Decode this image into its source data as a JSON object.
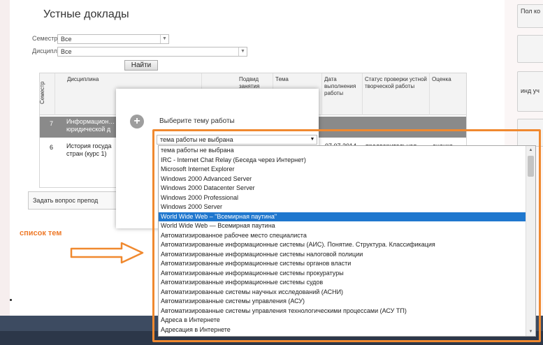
{
  "page": {
    "title": "Устные доклады",
    "filters": [
      {
        "label": "Семестр",
        "value": "Все"
      },
      {
        "label": "Дисциплина",
        "value": "Все"
      }
    ],
    "search_button": "Найти",
    "ask_teacher": "Задать вопрос препод"
  },
  "grid": {
    "headers": {
      "semester": "Семестр",
      "discipline": "Дисциплина",
      "submission": "Подвид занятия",
      "topic": "Тема",
      "date": "Дата выполнения работы",
      "status": "Статус проверки устной творческой работы",
      "grade": "Оценка"
    },
    "rows": [
      {
        "semester": "7",
        "discipline": "Информацион… юридической д",
        "date": "",
        "status": "",
        "grade": ""
      },
      {
        "semester": "6",
        "discipline": "История госуда стран (курс 1)",
        "date": "07.07.2014",
        "status": "предварительная",
        "grade": "оценка"
      }
    ]
  },
  "side_buttons": [
    {
      "label": "Пол ко"
    },
    {
      "label": ""
    },
    {
      "label": "инд уч"
    },
    {
      "label": ""
    }
  ],
  "dialog": {
    "prompt": "Выберите тему работы",
    "selected_value": "тема работы не выбрана"
  },
  "topic_list": {
    "items": [
      "тема работы не выбрана",
      "IRC - Internet Chat Relay (Беседа через Интернет)",
      "Microsoft Internet Explorer",
      "Windows 2000 Advanced Server",
      "Windows 2000 Datacenter Server",
      "Windows 2000 Professional",
      "Windows 2000 Server",
      "World Wide Web – \"Всемирная паутина\"",
      "World Wide Web — Всемирная паутина",
      "Автоматизированное рабочее место специалиста",
      "Автоматизированные информационные системы (АИС). Понятие. Структура. Классификация",
      "Автоматизированные информационные системы налоговой полиции",
      "Автоматизированные информационные системы органов власти",
      "Автоматизированные информационные системы прокуратуры",
      "Автоматизированные информационные системы судов",
      "Автоматизированные системы научных исследований (АСНИ)",
      "Автоматизированные системы управления (АСУ)",
      "Автоматизированные системы управления технологическими процессами (АСУ ТП)",
      "Адреса в Интернете",
      "Адресация в Интернете"
    ],
    "selected_index": 7
  },
  "annotation": {
    "label": "список тем",
    "color": "#f0892f"
  }
}
